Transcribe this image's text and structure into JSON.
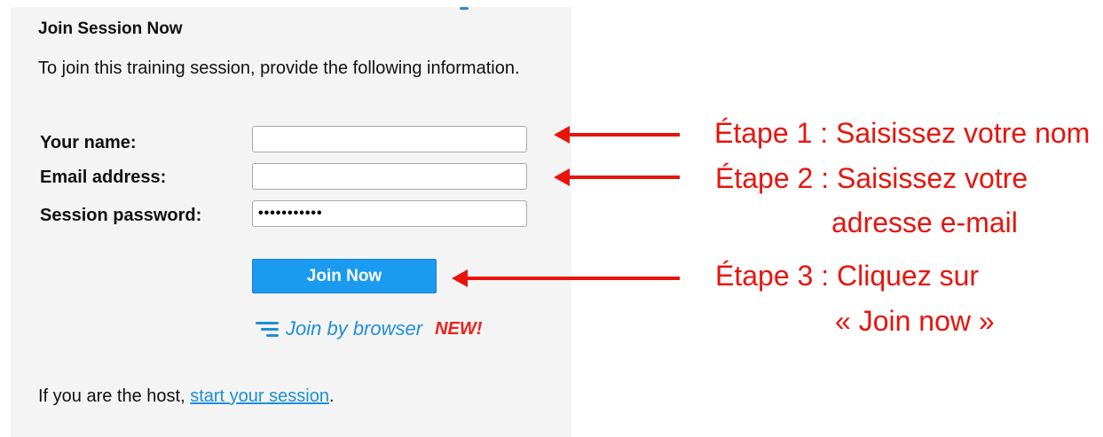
{
  "form": {
    "title": "Join Session Now",
    "intro": "To join this training session, provide the following information.",
    "name_label": "Your name:",
    "name_value": "",
    "email_label": "Email address:",
    "email_value": "",
    "password_label": "Session password:",
    "password_value": "•••••••••••",
    "join_button": "Join Now",
    "join_by_browser": "Join by browser",
    "new_badge": "NEW!",
    "host_prefix": "If you are the host, ",
    "host_link": "start your session",
    "host_suffix": "."
  },
  "annotations": {
    "step1": "Étape 1 : Saisissez votre nom",
    "step2_line1": "Étape 2 : Saisissez votre",
    "step2_line2": "adresse e-mail",
    "step3_line1": "Étape 3 : Cliquez sur",
    "step3_line2": "« Join now »"
  },
  "colors": {
    "annotation_red": "#e8140c",
    "button_blue": "#1a9bf0",
    "link_blue": "#1f8fd6",
    "new_red": "#e8231d",
    "panel_bg": "#f4f4f4"
  },
  "icons": {
    "join_by_browser": "browser-lines-icon"
  }
}
